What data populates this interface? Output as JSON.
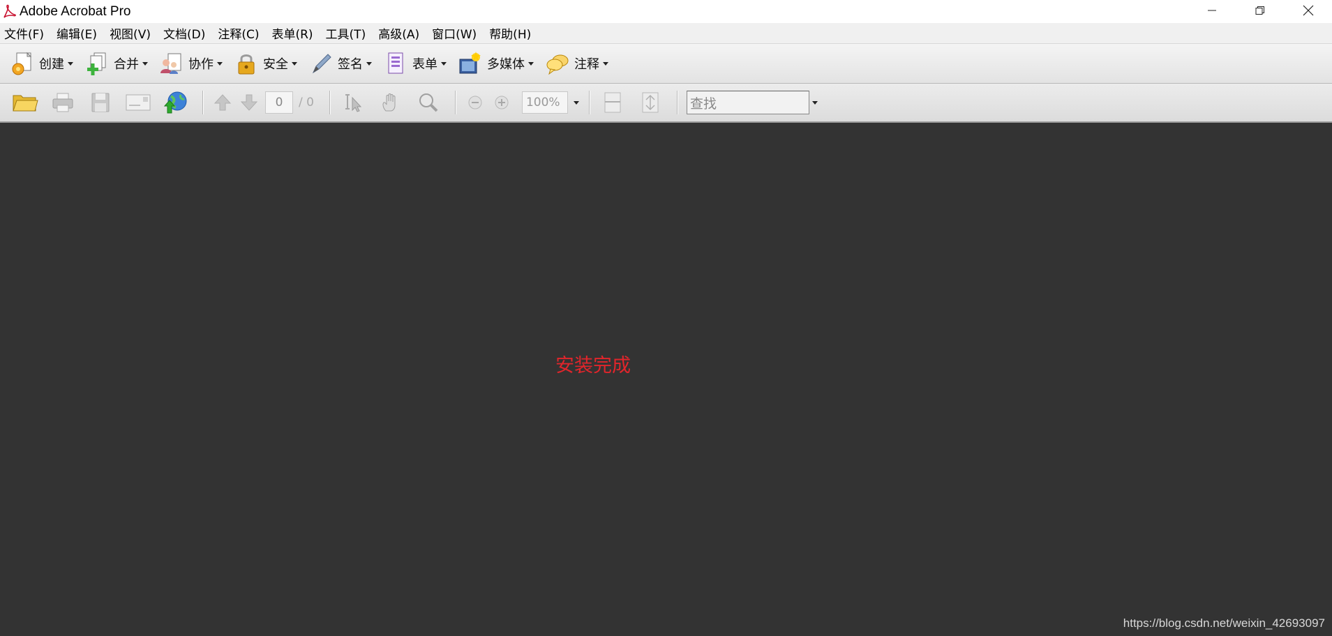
{
  "window": {
    "title": "Adobe Acrobat Pro",
    "controls": [
      "minimize-icon",
      "restore-icon",
      "close-icon"
    ]
  },
  "menubar": {
    "items": [
      {
        "label": "文件(F)"
      },
      {
        "label": "编辑(E)"
      },
      {
        "label": "视图(V)"
      },
      {
        "label": "文档(D)"
      },
      {
        "label": "注释(C)"
      },
      {
        "label": "表单(R)"
      },
      {
        "label": "工具(T)"
      },
      {
        "label": "高级(A)"
      },
      {
        "label": "窗口(W)"
      },
      {
        "label": "帮助(H)"
      }
    ]
  },
  "tasks": {
    "items": [
      {
        "label": "创建",
        "icon": "create-gear-icon"
      },
      {
        "label": "合并",
        "icon": "combine-icon"
      },
      {
        "label": "协作",
        "icon": "collaborate-icon"
      },
      {
        "label": "安全",
        "icon": "lock-icon"
      },
      {
        "label": "签名",
        "icon": "pen-icon"
      },
      {
        "label": "表单",
        "icon": "form-icon"
      },
      {
        "label": "多媒体",
        "icon": "multimedia-icon"
      },
      {
        "label": "注释",
        "icon": "comment-icon"
      }
    ]
  },
  "filebar": {
    "page_current": "0",
    "page_total": "/ 0",
    "zoom": "100%",
    "find_placeholder": "查找"
  },
  "document": {
    "message": "安装完成",
    "watermark": "https://blog.csdn.net/weixin_42693097"
  },
  "colors": {
    "doc_background": "#333333",
    "message": "#e2252b",
    "acrobat_red": "#c8102e"
  }
}
